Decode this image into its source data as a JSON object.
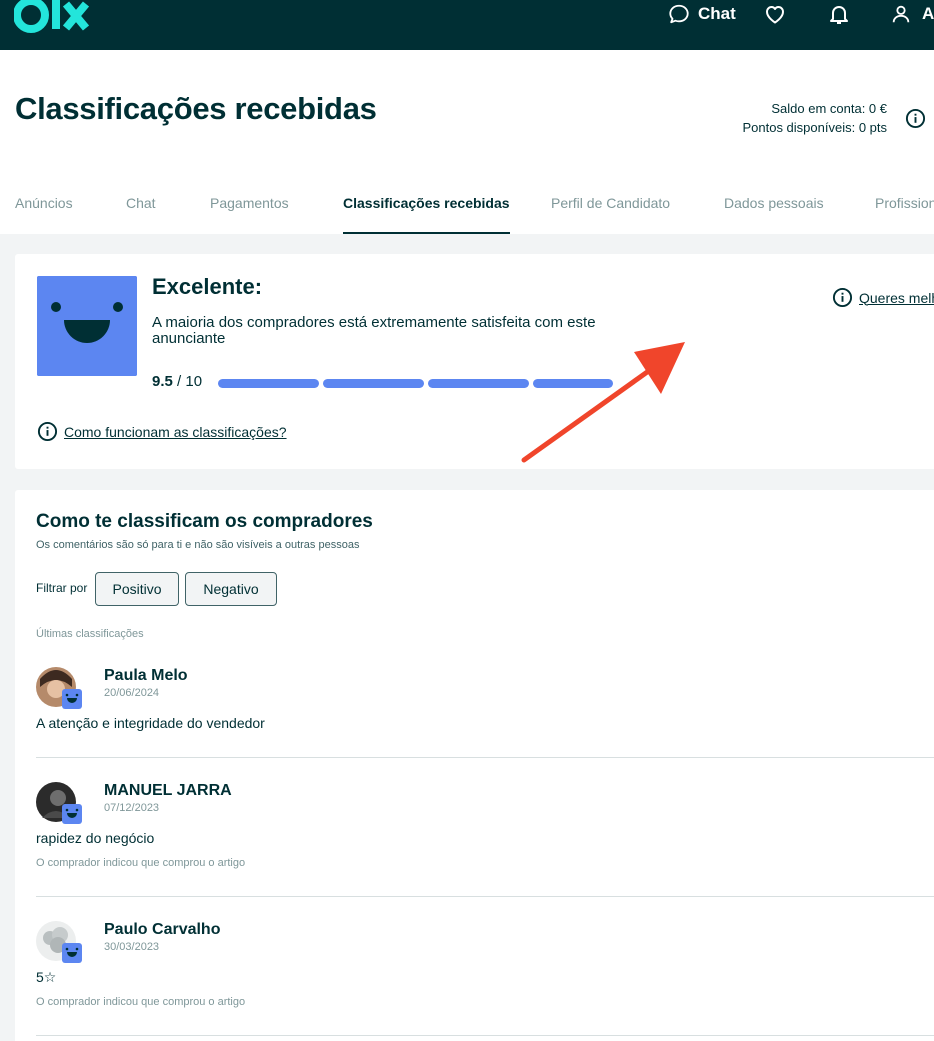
{
  "header": {
    "logo_text": "olx",
    "chat_label": "Chat",
    "user_label": "A",
    "icons": [
      "chat-bubble-icon",
      "heart-icon",
      "bell-icon",
      "user-icon"
    ],
    "colors": {
      "background": "#002f34",
      "logo": "#23e5db",
      "text": "#ffffff"
    }
  },
  "page": {
    "title": "Classificações recebidas",
    "balance_line": "Saldo em conta: 0 €",
    "points_line": "Pontos disponíveis: 0 pts"
  },
  "tabs": [
    {
      "label": "Anúncios",
      "active": false
    },
    {
      "label": "Chat",
      "active": false
    },
    {
      "label": "Pagamentos",
      "active": false
    },
    {
      "label": "Classificações recebidas",
      "active": true
    },
    {
      "label": "Perfil de Candidato",
      "active": false
    },
    {
      "label": "Dados pessoais",
      "active": false
    },
    {
      "label": "Profission",
      "active": false
    }
  ],
  "rating": {
    "title": "Excelente:",
    "description": "A maioria dos compradores está extremamente satisfeita com este anunciante",
    "score": "9.5",
    "score_max": "/ 10",
    "score_value": 9.5,
    "score_bar_segments": 4,
    "how_link": "Como funcionam as classificações?",
    "improve_link": "Queres melh",
    "accent_color": "#5c86f1"
  },
  "reviews": {
    "title": "Como te classificam os compradores",
    "subtitle": "Os comentários são só para ti e não são visíveis a outras pessoas",
    "filter_label": "Filtrar por",
    "filter_positive": "Positivo",
    "filter_negative": "Negativo",
    "latest_label": "Últimas classificações",
    "items": [
      {
        "name": "Paula Melo",
        "date": "20/06/2024",
        "comment": "A atenção e integridade do vendedor",
        "note": ""
      },
      {
        "name": "MANUEL JARRA",
        "date": "07/12/2023",
        "comment": "rapidez do negócio",
        "note": "O comprador indicou que comprou o artigo"
      },
      {
        "name": "Paulo Carvalho",
        "date": "30/03/2023",
        "comment": "5☆",
        "note": "O comprador indicou que comprou o artigo"
      }
    ]
  },
  "annotation": {
    "arrow_color": "#f0452b"
  }
}
